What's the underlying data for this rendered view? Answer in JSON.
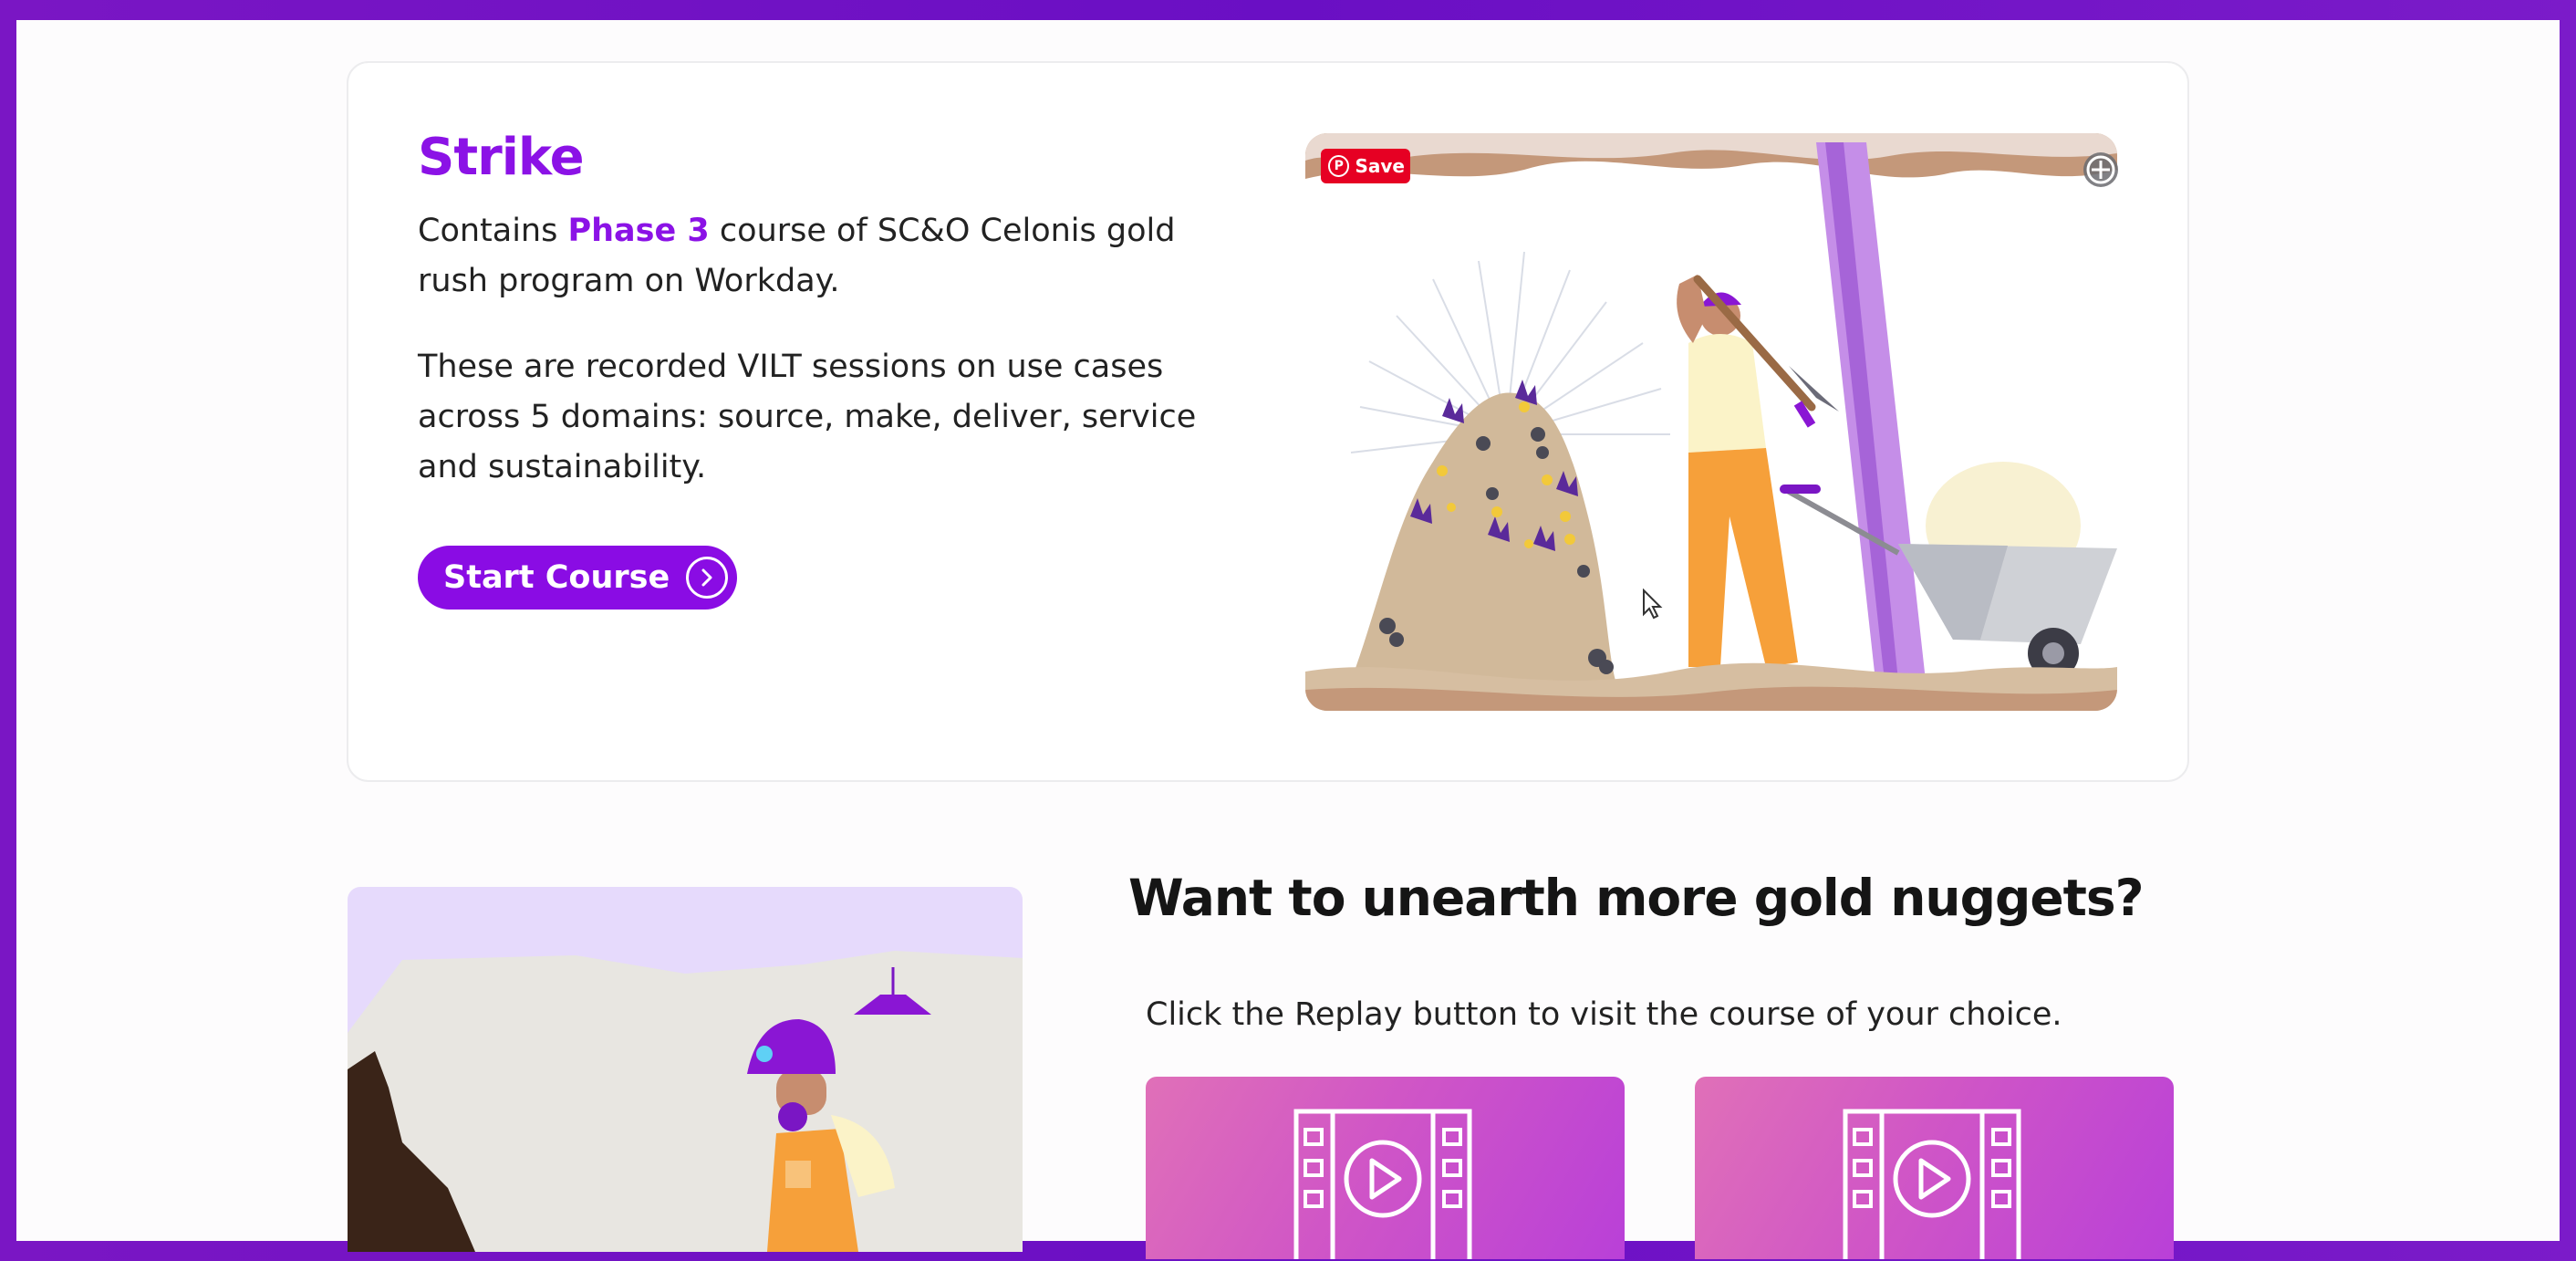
{
  "card": {
    "title": "Strike",
    "intro_before": "Contains ",
    "intro_highlight": "Phase 3",
    "intro_after": " course of SC&O Celonis gold rush program on Workday.",
    "description": "These are recorded VILT sessions on use cases across 5 domains: source, make, deliver, service and sustainability.",
    "start_button_label": "Start Course",
    "illustration": {
      "save_label": "Save",
      "icons": [
        "pinterest-icon",
        "expand-icon"
      ]
    }
  },
  "more": {
    "heading": "Want to unearth more gold nuggets?",
    "subheading": "Click the Replay button to visit the course of your choice.",
    "video_cards": [
      {
        "icon": "video-film-icon"
      },
      {
        "icon": "video-film-icon"
      }
    ]
  },
  "colors": {
    "accent": "#8a0ce4",
    "frame": "#6a0fc4",
    "pinterest": "#e60023"
  }
}
